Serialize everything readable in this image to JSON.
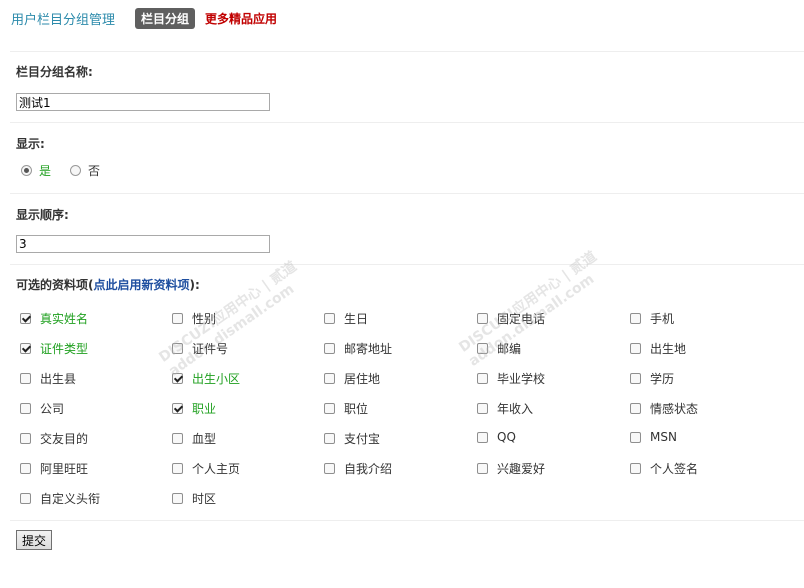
{
  "header": {
    "title": "用户栏目分组管理",
    "active_tab": "栏目分组",
    "more_link": "更多精品应用"
  },
  "form": {
    "group_name_label": "栏目分组名称:",
    "group_name_value": "测试1",
    "display_label": "显示:",
    "display_yes": "是",
    "display_no": "否",
    "display_selected": "是",
    "order_label": "显示顺序:",
    "order_value": "3",
    "options_label_prefix": "可选的资料项(",
    "options_label_link": "点此启用新资料项",
    "options_label_suffix": "):",
    "submit_label": "提交"
  },
  "options": [
    {
      "label": "真实姓名",
      "checked": true
    },
    {
      "label": "性别",
      "checked": false
    },
    {
      "label": "生日",
      "checked": false
    },
    {
      "label": "固定电话",
      "checked": false
    },
    {
      "label": "手机",
      "checked": false
    },
    {
      "label": "证件类型",
      "checked": true
    },
    {
      "label": "证件号",
      "checked": false
    },
    {
      "label": "邮寄地址",
      "checked": false
    },
    {
      "label": "邮编",
      "checked": false
    },
    {
      "label": "出生地",
      "checked": false
    },
    {
      "label": "出生县",
      "checked": false
    },
    {
      "label": "出生小区",
      "checked": true
    },
    {
      "label": "居住地",
      "checked": false
    },
    {
      "label": "毕业学校",
      "checked": false
    },
    {
      "label": "学历",
      "checked": false
    },
    {
      "label": "公司",
      "checked": false
    },
    {
      "label": "职业",
      "checked": true
    },
    {
      "label": "职位",
      "checked": false
    },
    {
      "label": "年收入",
      "checked": false
    },
    {
      "label": "情感状态",
      "checked": false
    },
    {
      "label": "交友目的",
      "checked": false
    },
    {
      "label": "血型",
      "checked": false
    },
    {
      "label": "支付宝",
      "checked": false
    },
    {
      "label": "QQ",
      "checked": false
    },
    {
      "label": "MSN",
      "checked": false
    },
    {
      "label": "阿里旺旺",
      "checked": false
    },
    {
      "label": "个人主页",
      "checked": false
    },
    {
      "label": "自我介绍",
      "checked": false
    },
    {
      "label": "兴趣爱好",
      "checked": false
    },
    {
      "label": "个人签名",
      "checked": false
    },
    {
      "label": "自定义头衔",
      "checked": false
    },
    {
      "label": "时区",
      "checked": false
    }
  ],
  "watermark": {
    "text1": "DISCUZ!应用中心 | 贰道",
    "text2": "addon.dismall.com"
  }
}
